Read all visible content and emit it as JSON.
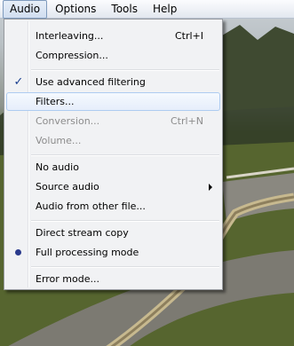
{
  "menubar": {
    "items": [
      "Audio",
      "Options",
      "Tools",
      "Help"
    ],
    "active": "Audio"
  },
  "audio_menu": {
    "items": [
      {
        "label": "Interleaving...",
        "shortcut": "Ctrl+I"
      },
      {
        "label": "Compression..."
      },
      {
        "label": "Use advanced filtering",
        "checked": true
      },
      {
        "label": "Filters...",
        "hovered": true
      },
      {
        "label": "Conversion...",
        "shortcut": "Ctrl+N",
        "disabled": true
      },
      {
        "label": "Volume...",
        "disabled": true
      },
      {
        "label": "No audio"
      },
      {
        "label": "Source audio",
        "submenu": true
      },
      {
        "label": "Audio from other file..."
      },
      {
        "label": "Direct stream copy"
      },
      {
        "label": "Full processing mode",
        "selected_radio": true
      },
      {
        "label": "Error mode..."
      }
    ]
  },
  "background": {
    "description_icon": "race-track-scene"
  }
}
